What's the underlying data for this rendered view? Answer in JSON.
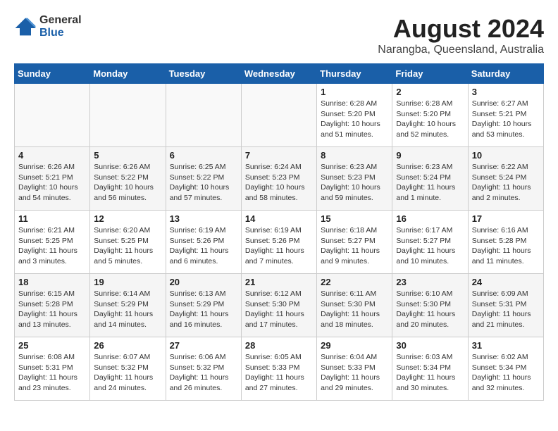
{
  "header": {
    "logo": {
      "general": "General",
      "blue": "Blue"
    },
    "title": "August 2024",
    "subtitle": "Narangba, Queensland, Australia"
  },
  "weekdays": [
    "Sunday",
    "Monday",
    "Tuesday",
    "Wednesday",
    "Thursday",
    "Friday",
    "Saturday"
  ],
  "weeks": [
    [
      {
        "day": "",
        "info": ""
      },
      {
        "day": "",
        "info": ""
      },
      {
        "day": "",
        "info": ""
      },
      {
        "day": "",
        "info": ""
      },
      {
        "day": "1",
        "info": "Sunrise: 6:28 AM\nSunset: 5:20 PM\nDaylight: 10 hours\nand 51 minutes."
      },
      {
        "day": "2",
        "info": "Sunrise: 6:28 AM\nSunset: 5:20 PM\nDaylight: 10 hours\nand 52 minutes."
      },
      {
        "day": "3",
        "info": "Sunrise: 6:27 AM\nSunset: 5:21 PM\nDaylight: 10 hours\nand 53 minutes."
      }
    ],
    [
      {
        "day": "4",
        "info": "Sunrise: 6:26 AM\nSunset: 5:21 PM\nDaylight: 10 hours\nand 54 minutes."
      },
      {
        "day": "5",
        "info": "Sunrise: 6:26 AM\nSunset: 5:22 PM\nDaylight: 10 hours\nand 56 minutes."
      },
      {
        "day": "6",
        "info": "Sunrise: 6:25 AM\nSunset: 5:22 PM\nDaylight: 10 hours\nand 57 minutes."
      },
      {
        "day": "7",
        "info": "Sunrise: 6:24 AM\nSunset: 5:23 PM\nDaylight: 10 hours\nand 58 minutes."
      },
      {
        "day": "8",
        "info": "Sunrise: 6:23 AM\nSunset: 5:23 PM\nDaylight: 10 hours\nand 59 minutes."
      },
      {
        "day": "9",
        "info": "Sunrise: 6:23 AM\nSunset: 5:24 PM\nDaylight: 11 hours\nand 1 minute."
      },
      {
        "day": "10",
        "info": "Sunrise: 6:22 AM\nSunset: 5:24 PM\nDaylight: 11 hours\nand 2 minutes."
      }
    ],
    [
      {
        "day": "11",
        "info": "Sunrise: 6:21 AM\nSunset: 5:25 PM\nDaylight: 11 hours\nand 3 minutes."
      },
      {
        "day": "12",
        "info": "Sunrise: 6:20 AM\nSunset: 5:25 PM\nDaylight: 11 hours\nand 5 minutes."
      },
      {
        "day": "13",
        "info": "Sunrise: 6:19 AM\nSunset: 5:26 PM\nDaylight: 11 hours\nand 6 minutes."
      },
      {
        "day": "14",
        "info": "Sunrise: 6:19 AM\nSunset: 5:26 PM\nDaylight: 11 hours\nand 7 minutes."
      },
      {
        "day": "15",
        "info": "Sunrise: 6:18 AM\nSunset: 5:27 PM\nDaylight: 11 hours\nand 9 minutes."
      },
      {
        "day": "16",
        "info": "Sunrise: 6:17 AM\nSunset: 5:27 PM\nDaylight: 11 hours\nand 10 minutes."
      },
      {
        "day": "17",
        "info": "Sunrise: 6:16 AM\nSunset: 5:28 PM\nDaylight: 11 hours\nand 11 minutes."
      }
    ],
    [
      {
        "day": "18",
        "info": "Sunrise: 6:15 AM\nSunset: 5:28 PM\nDaylight: 11 hours\nand 13 minutes."
      },
      {
        "day": "19",
        "info": "Sunrise: 6:14 AM\nSunset: 5:29 PM\nDaylight: 11 hours\nand 14 minutes."
      },
      {
        "day": "20",
        "info": "Sunrise: 6:13 AM\nSunset: 5:29 PM\nDaylight: 11 hours\nand 16 minutes."
      },
      {
        "day": "21",
        "info": "Sunrise: 6:12 AM\nSunset: 5:30 PM\nDaylight: 11 hours\nand 17 minutes."
      },
      {
        "day": "22",
        "info": "Sunrise: 6:11 AM\nSunset: 5:30 PM\nDaylight: 11 hours\nand 18 minutes."
      },
      {
        "day": "23",
        "info": "Sunrise: 6:10 AM\nSunset: 5:30 PM\nDaylight: 11 hours\nand 20 minutes."
      },
      {
        "day": "24",
        "info": "Sunrise: 6:09 AM\nSunset: 5:31 PM\nDaylight: 11 hours\nand 21 minutes."
      }
    ],
    [
      {
        "day": "25",
        "info": "Sunrise: 6:08 AM\nSunset: 5:31 PM\nDaylight: 11 hours\nand 23 minutes."
      },
      {
        "day": "26",
        "info": "Sunrise: 6:07 AM\nSunset: 5:32 PM\nDaylight: 11 hours\nand 24 minutes."
      },
      {
        "day": "27",
        "info": "Sunrise: 6:06 AM\nSunset: 5:32 PM\nDaylight: 11 hours\nand 26 minutes."
      },
      {
        "day": "28",
        "info": "Sunrise: 6:05 AM\nSunset: 5:33 PM\nDaylight: 11 hours\nand 27 minutes."
      },
      {
        "day": "29",
        "info": "Sunrise: 6:04 AM\nSunset: 5:33 PM\nDaylight: 11 hours\nand 29 minutes."
      },
      {
        "day": "30",
        "info": "Sunrise: 6:03 AM\nSunset: 5:34 PM\nDaylight: 11 hours\nand 30 minutes."
      },
      {
        "day": "31",
        "info": "Sunrise: 6:02 AM\nSunset: 5:34 PM\nDaylight: 11 hours\nand 32 minutes."
      }
    ]
  ]
}
